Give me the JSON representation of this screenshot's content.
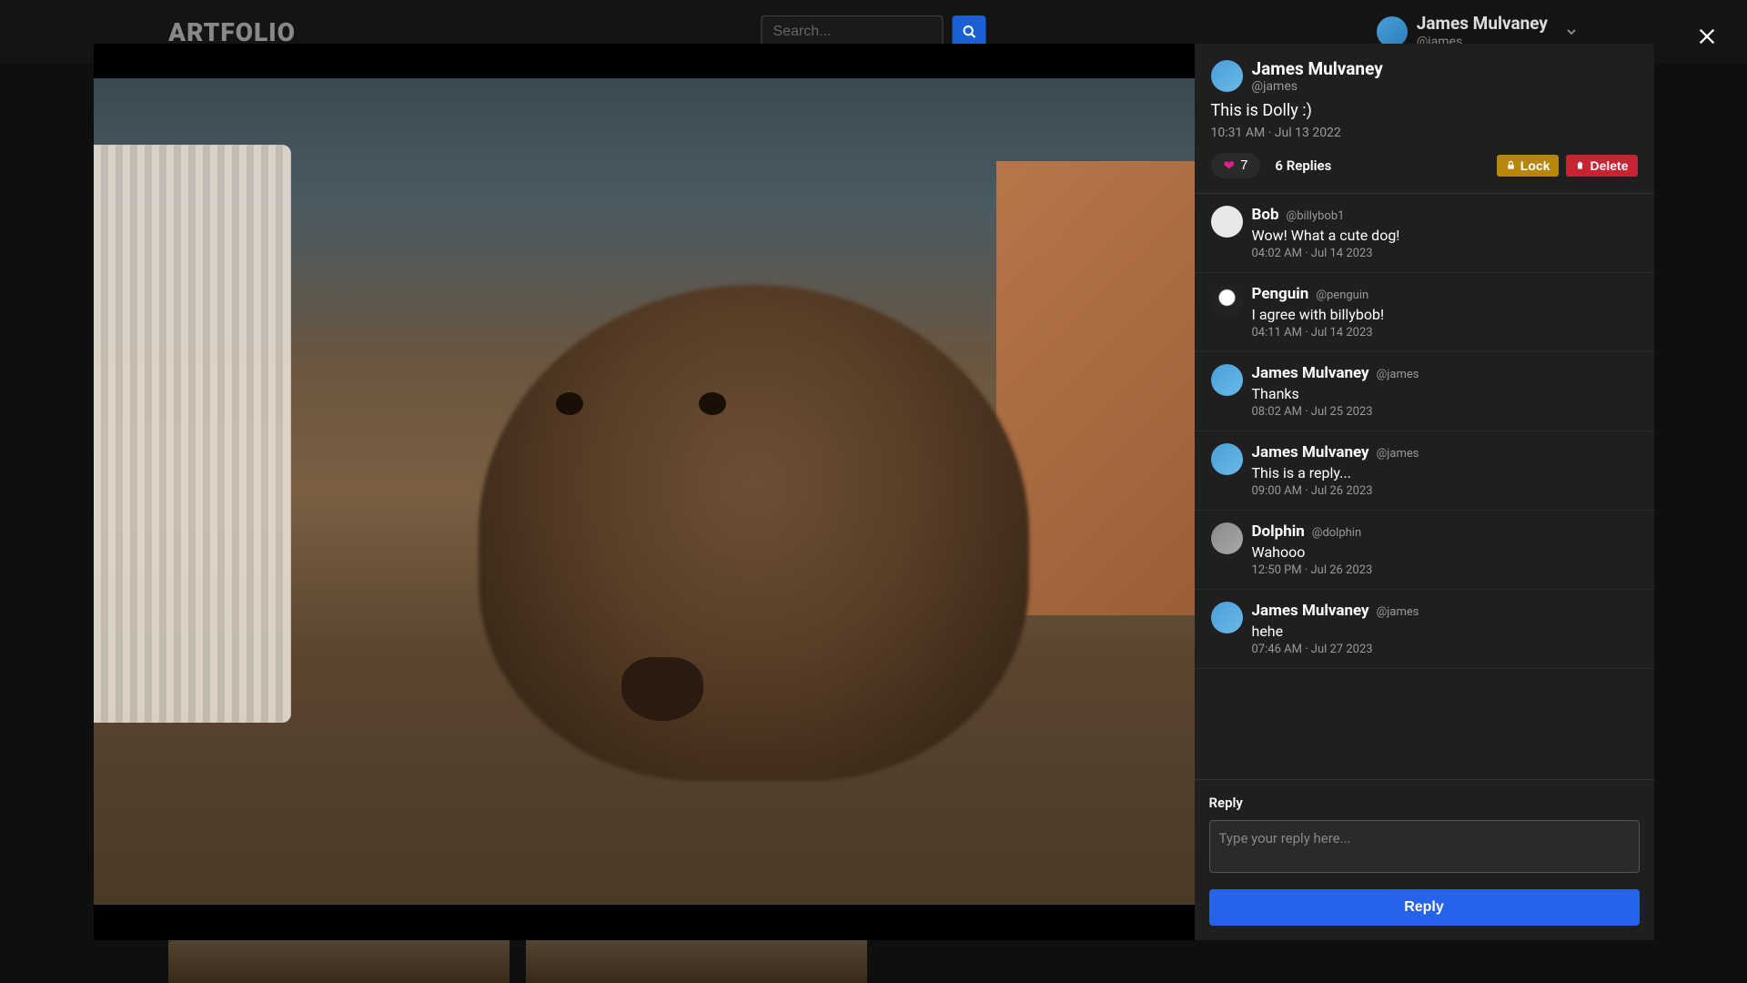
{
  "nav": {
    "brand": "ARTFOLIO",
    "search_placeholder": "Search...",
    "user_name": "James Mulvaney",
    "user_handle": "@james"
  },
  "post": {
    "author_name": "James Mulvaney",
    "author_handle": "@james",
    "caption": "This is Dolly :)",
    "timestamp": "10:31 AM · Jul 13 2022",
    "like_count": "7",
    "replies_label": "6 Replies",
    "lock_label": "Lock",
    "delete_label": "Delete"
  },
  "replies": [
    {
      "name": "Bob",
      "handle": "@billybob1",
      "text": "Wow! What a cute dog!",
      "time": "04:02 AM · Jul 14 2023",
      "avatar": "bob"
    },
    {
      "name": "Penguin",
      "handle": "@penguin",
      "text": "I agree with billybob!",
      "time": "04:11 AM · Jul 14 2023",
      "avatar": "penguin"
    },
    {
      "name": "James Mulvaney",
      "handle": "@james",
      "text": "Thanks",
      "time": "08:02 AM · Jul 25 2023",
      "avatar": "james"
    },
    {
      "name": "James Mulvaney",
      "handle": "@james",
      "text": "This is a reply...",
      "time": "09:00 AM · Jul 26 2023",
      "avatar": "james"
    },
    {
      "name": "Dolphin",
      "handle": "@dolphin",
      "text": "Wahooo",
      "time": "12:50 PM · Jul 26 2023",
      "avatar": "dolphin"
    },
    {
      "name": "James Mulvaney",
      "handle": "@james",
      "text": "hehe",
      "time": "07:46 AM · Jul 27 2023",
      "avatar": "james"
    }
  ],
  "composer": {
    "label": "Reply",
    "placeholder": "Type your reply here...",
    "submit": "Reply"
  }
}
